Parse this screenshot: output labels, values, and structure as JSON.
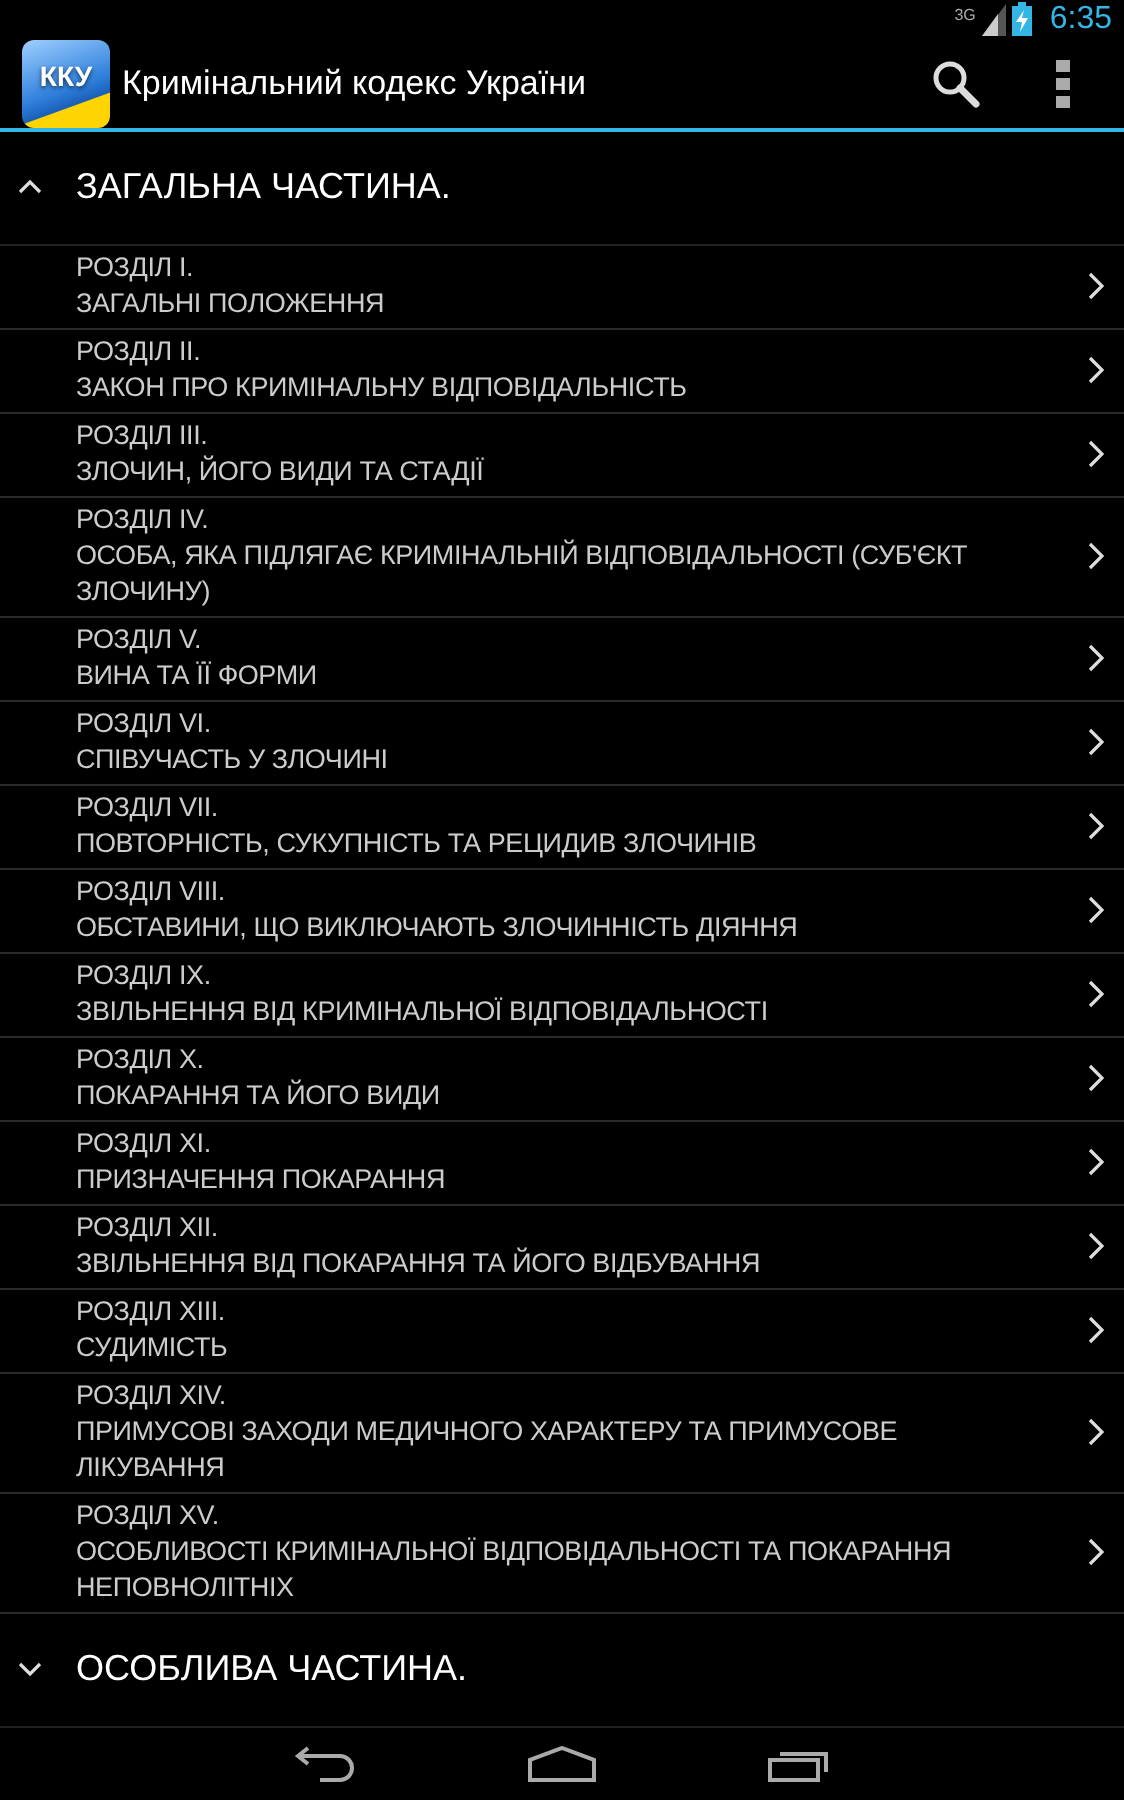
{
  "status_bar": {
    "network": "3G",
    "time": "6:35"
  },
  "action_bar": {
    "logo": "ККУ",
    "title": "Кримінальний кодекс України"
  },
  "groups": [
    {
      "title": "ЗАГАЛЬНА ЧАСТИНА.",
      "expanded": true,
      "sections": [
        {
          "number": "РОЗДІЛ I.",
          "name": "ЗАГАЛЬНІ ПОЛОЖЕННЯ"
        },
        {
          "number": "РОЗДІЛ II.",
          "name": "ЗАКОН ПРО КРИМІНАЛЬНУ ВІДПОВІДАЛЬНІСТЬ"
        },
        {
          "number": "РОЗДІЛ III.",
          "name": "ЗЛОЧИН, ЙОГО ВИДИ ТА СТАДІЇ"
        },
        {
          "number": "РОЗДІЛ IV.",
          "name": "ОСОБА, ЯКА ПІДЛЯГАЄ КРИМІНАЛЬНІЙ ВІДПОВІДАЛЬНОСТІ (СУБ'ЄКТ ЗЛОЧИНУ)"
        },
        {
          "number": "РОЗДІЛ V.",
          "name": "ВИНА ТА ЇЇ ФОРМИ"
        },
        {
          "number": "РОЗДІЛ VI.",
          "name": "СПІВУЧАСТЬ У ЗЛОЧИНІ"
        },
        {
          "number": "РОЗДІЛ VII.",
          "name": "ПОВТОРНІСТЬ, СУКУПНІСТЬ ТА РЕЦИДИВ ЗЛОЧИНІВ"
        },
        {
          "number": "РОЗДІЛ VIII.",
          "name": "ОБСТАВИНИ, ЩО ВИКЛЮЧАЮТЬ ЗЛОЧИННІСТЬ ДІЯННЯ"
        },
        {
          "number": "РОЗДІЛ IX.",
          "name": "ЗВІЛЬНЕННЯ ВІД КРИМІНАЛЬНОЇ ВІДПОВІДАЛЬНОСТІ"
        },
        {
          "number": "РОЗДІЛ X.",
          "name": "ПОКАРАННЯ ТА ЙОГО ВИДИ"
        },
        {
          "number": "РОЗДІЛ XI.",
          "name": "ПРИЗНАЧЕННЯ ПОКАРАННЯ"
        },
        {
          "number": "РОЗДІЛ XII.",
          "name": "ЗВІЛЬНЕННЯ ВІД ПОКАРАННЯ ТА ЙОГО ВІДБУВАННЯ"
        },
        {
          "number": "РОЗДІЛ XIII.",
          "name": "СУДИМІСТЬ"
        },
        {
          "number": "РОЗДІЛ XIV.",
          "name": "ПРИМУСОВІ ЗАХОДИ МЕДИЧНОГО ХАРАКТЕРУ ТА ПРИМУСОВЕ ЛІКУВАННЯ"
        },
        {
          "number": "РОЗДІЛ XV.",
          "name": "ОСОБЛИВОСТІ КРИМІНАЛЬНОЇ ВІДПОВІДАЛЬНОСТІ ТА ПОКАРАННЯ НЕПОВНОЛІТНІХ"
        }
      ]
    },
    {
      "title": "ОСОБЛИВА ЧАСТИНА.",
      "expanded": false
    }
  ]
}
